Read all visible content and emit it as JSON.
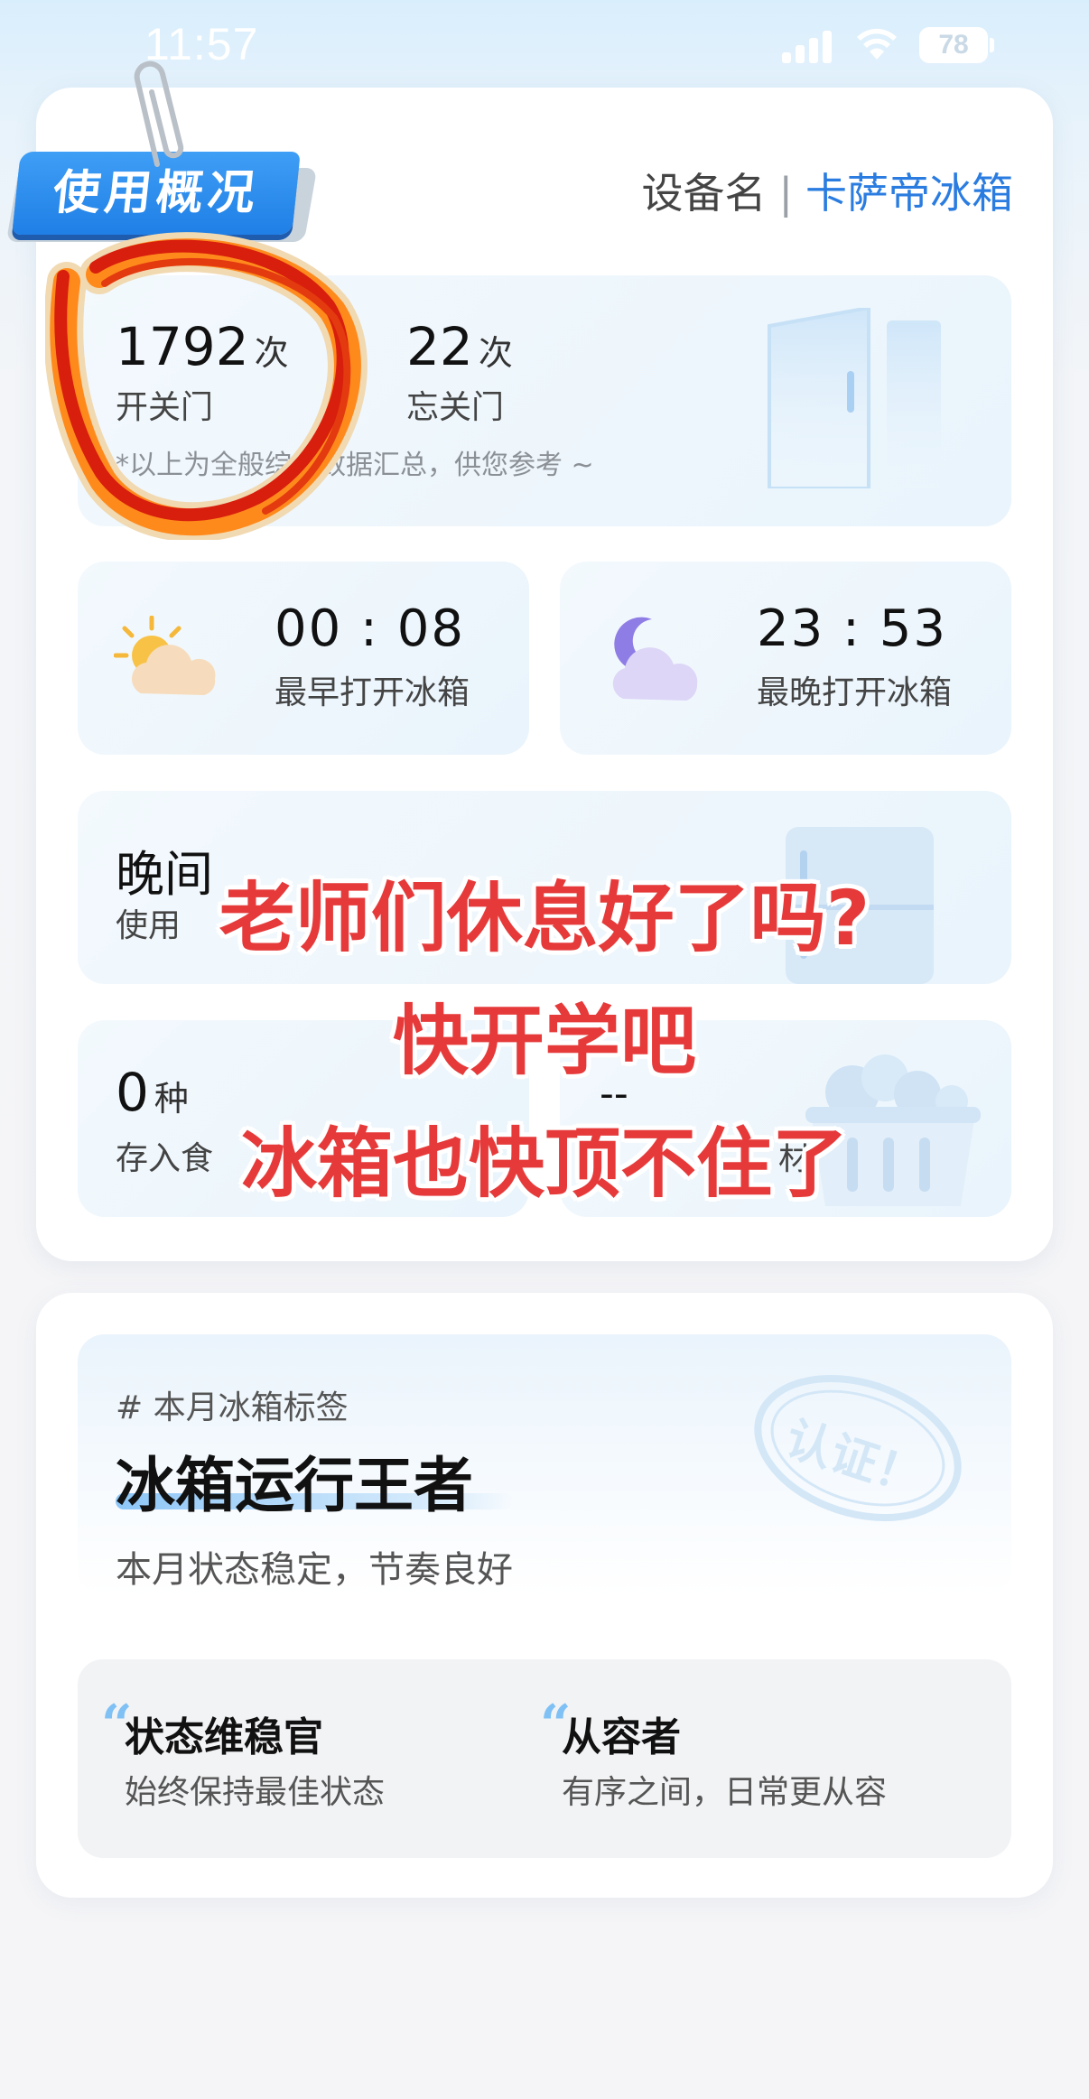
{
  "status_bar": {
    "time": "11:57",
    "battery": "78"
  },
  "header": {
    "tag": "使用概况",
    "device_label": "设备名",
    "device_separator": "|",
    "device_name": "卡萨帝冰箱"
  },
  "door_stats": {
    "open_close_count": "1792",
    "open_close_unit": "次",
    "open_close_label": "开关门",
    "forgot_count": "22",
    "forgot_unit": "次",
    "forgot_label": "忘关门",
    "note": "*以上为全般综合数据汇总，供您参考 ~"
  },
  "earliest": {
    "time": "00 : 08",
    "label": "最早打开冰箱"
  },
  "latest": {
    "time": "23 : 53",
    "label": "最晚打开冰箱"
  },
  "night": {
    "title": "晚间",
    "sub": "使用"
  },
  "food": {
    "count": "0",
    "unit": "种",
    "label": "存入食",
    "right_value": "--",
    "right_label": "材"
  },
  "overlay": {
    "line1": "老师们休息好了吗?",
    "line2": "快开学吧",
    "line3": "冰箱也快顶不住了"
  },
  "monthly": {
    "hash_label": "# 本月冰箱标签",
    "title": "冰箱运行王者",
    "desc": "本月状态稳定，节奏良好",
    "stamp": "认证！"
  },
  "badges": [
    {
      "title": "状态维稳官",
      "sub": "始终保持最佳状态"
    },
    {
      "title": "从容者",
      "sub": "有序之间，日常更从容"
    }
  ],
  "colors": {
    "accent": "#2a7ce0",
    "overlay_red": "#e63a3a",
    "tag_blue": "#2f8ff0"
  },
  "icons": [
    "signal-icon",
    "wifi-icon",
    "battery-icon",
    "paperclip-icon",
    "door-icon",
    "sun-cloud-icon",
    "moon-cloud-icon",
    "fridge-icon",
    "basket-icon",
    "stamp-icon",
    "quote-icon"
  ]
}
